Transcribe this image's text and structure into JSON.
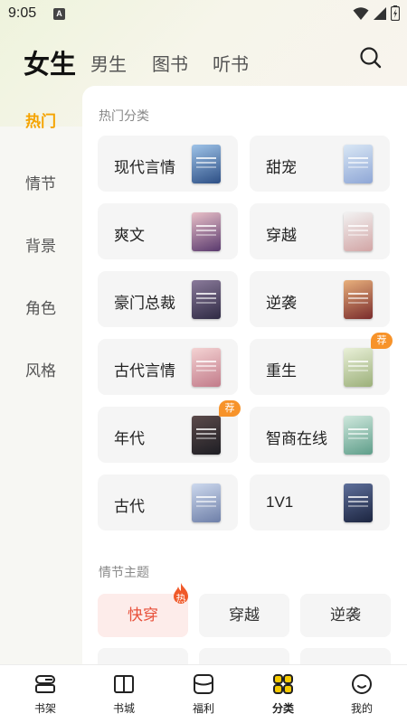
{
  "status_bar": {
    "time": "9:05",
    "notification_letter": "A"
  },
  "header": {
    "tabs": [
      {
        "label": "女生",
        "active": true
      },
      {
        "label": "男生",
        "active": false
      },
      {
        "label": "图书",
        "active": false
      },
      {
        "label": "听书",
        "active": false
      }
    ],
    "search_icon": "search-icon"
  },
  "side_nav": {
    "items": [
      {
        "label": "热门",
        "active": true
      },
      {
        "label": "情节",
        "active": false
      },
      {
        "label": "背景",
        "active": false
      },
      {
        "label": "角色",
        "active": false
      },
      {
        "label": "风格",
        "active": false
      }
    ]
  },
  "hot_categories": {
    "title": "热门分类",
    "items": [
      {
        "label": "现代言情",
        "badge": "",
        "cover_colors": [
          "#9ec3e8",
          "#2d4f85"
        ]
      },
      {
        "label": "甜宠",
        "badge": "",
        "cover_colors": [
          "#d9e7f5",
          "#8fa7d6"
        ]
      },
      {
        "label": "爽文",
        "badge": "",
        "cover_colors": [
          "#e9c0c8",
          "#5a3a6e"
        ]
      },
      {
        "label": "穿越",
        "badge": "",
        "cover_colors": [
          "#f2f2f2",
          "#d2a5a5"
        ]
      },
      {
        "label": "豪门总裁",
        "badge": "",
        "cover_colors": [
          "#8a7a9a",
          "#2f2a44"
        ]
      },
      {
        "label": "逆袭",
        "badge": "",
        "cover_colors": [
          "#e8b07c",
          "#7a2c2c"
        ]
      },
      {
        "label": "古代言情",
        "badge": "",
        "cover_colors": [
          "#f4d3d3",
          "#c27b8a"
        ]
      },
      {
        "label": "重生",
        "badge": "荐",
        "cover_colors": [
          "#e9f0d8",
          "#9cb07a"
        ]
      },
      {
        "label": "年代",
        "badge": "荐",
        "cover_colors": [
          "#5b4a4a",
          "#1e1e24"
        ]
      },
      {
        "label": "智商在线",
        "badge": "",
        "cover_colors": [
          "#cfe8dd",
          "#5f9e8a"
        ]
      },
      {
        "label": "古代",
        "badge": "",
        "cover_colors": [
          "#cdd9ee",
          "#6e7fa8"
        ]
      },
      {
        "label": "1V1",
        "badge": "",
        "cover_colors": [
          "#5e6f9a",
          "#1c2540"
        ]
      }
    ]
  },
  "plot_themes": {
    "title": "情节主题",
    "chips": [
      {
        "label": "快穿",
        "hot": true,
        "badge": "热"
      },
      {
        "label": "穿越",
        "hot": false,
        "badge": ""
      },
      {
        "label": "逆袭",
        "hot": false,
        "badge": ""
      }
    ]
  },
  "bottom_nav": {
    "items": [
      {
        "label": "书架",
        "icon": "bookshelf-icon",
        "active": false
      },
      {
        "label": "书城",
        "icon": "open-book-icon",
        "active": false
      },
      {
        "label": "福利",
        "icon": "gift-box-icon",
        "active": false
      },
      {
        "label": "分类",
        "icon": "category-grid-icon",
        "active": true
      },
      {
        "label": "我的",
        "icon": "profile-smile-icon",
        "active": false
      }
    ]
  },
  "colors": {
    "accent": "#f5a300",
    "highlight": "#f5c900",
    "hot_red": "#e8503a",
    "badge_orange": "#f7932a"
  }
}
